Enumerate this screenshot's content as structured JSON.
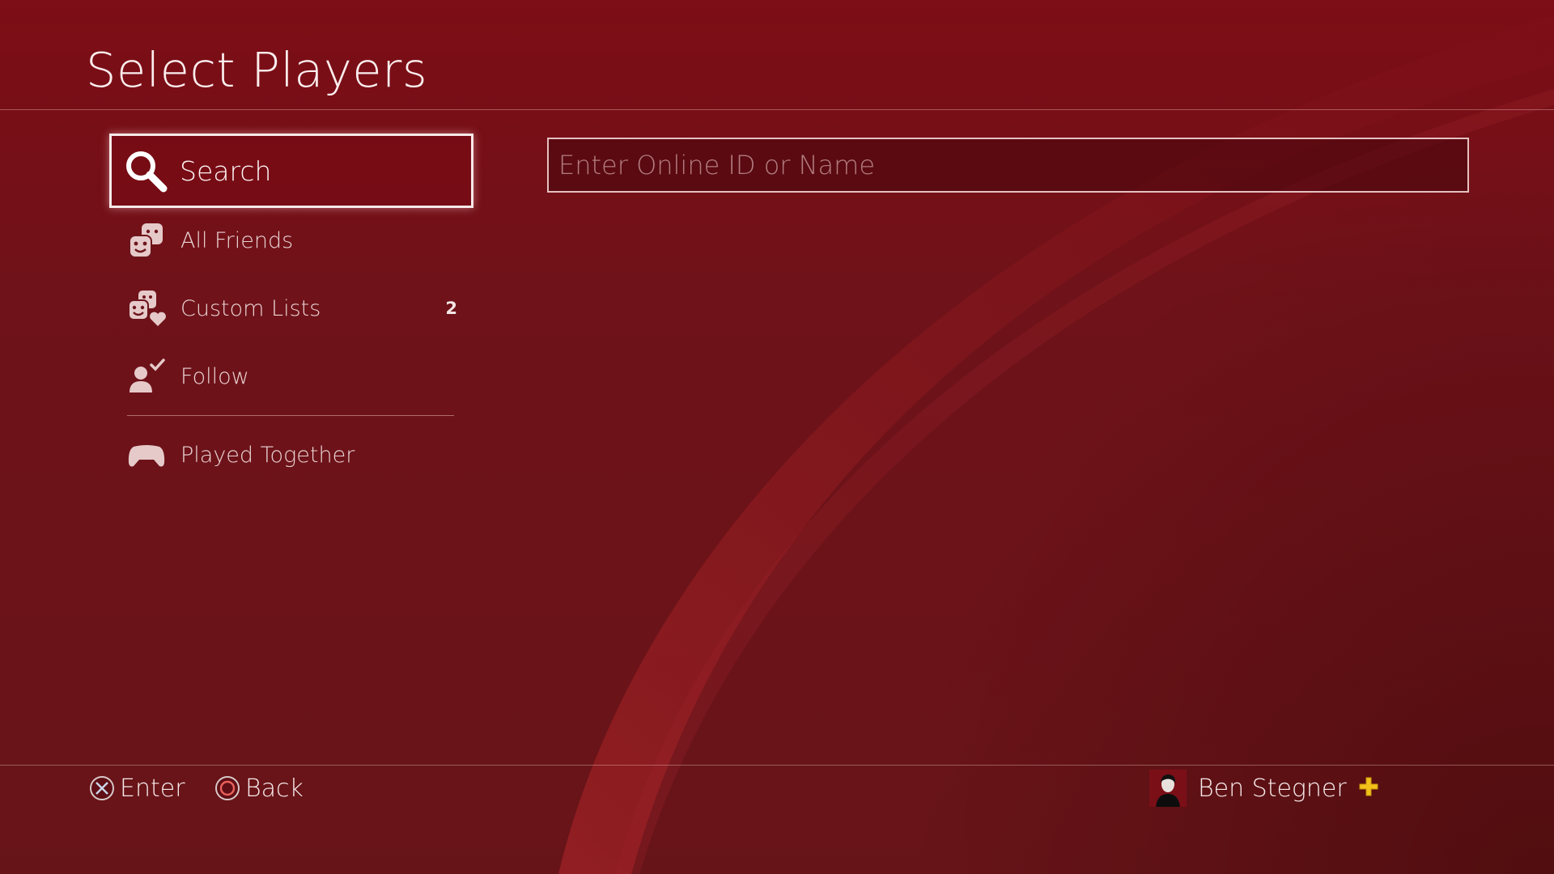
{
  "header": {
    "title": "Select Players"
  },
  "sidebar": {
    "items": [
      {
        "label": "Search",
        "icon": "search-icon",
        "selected": true
      },
      {
        "label": "All Friends",
        "icon": "friends-icon"
      },
      {
        "label": "Custom Lists",
        "icon": "custom-lists-icon",
        "count": "2"
      },
      {
        "label": "Follow",
        "icon": "follow-icon"
      },
      {
        "label": "Played Together",
        "icon": "controller-icon"
      }
    ]
  },
  "search": {
    "placeholder": "Enter Online ID or Name",
    "value": ""
  },
  "footer": {
    "enter_label": "Enter",
    "enter_icon": "cross-button-icon",
    "back_label": "Back",
    "back_icon": "circle-button-icon",
    "user_name": "Ben Stegner",
    "plus_icon": "playstation-plus-icon"
  },
  "colors": {
    "background": "#6a1218",
    "accent_plus": "#f2c21b"
  }
}
